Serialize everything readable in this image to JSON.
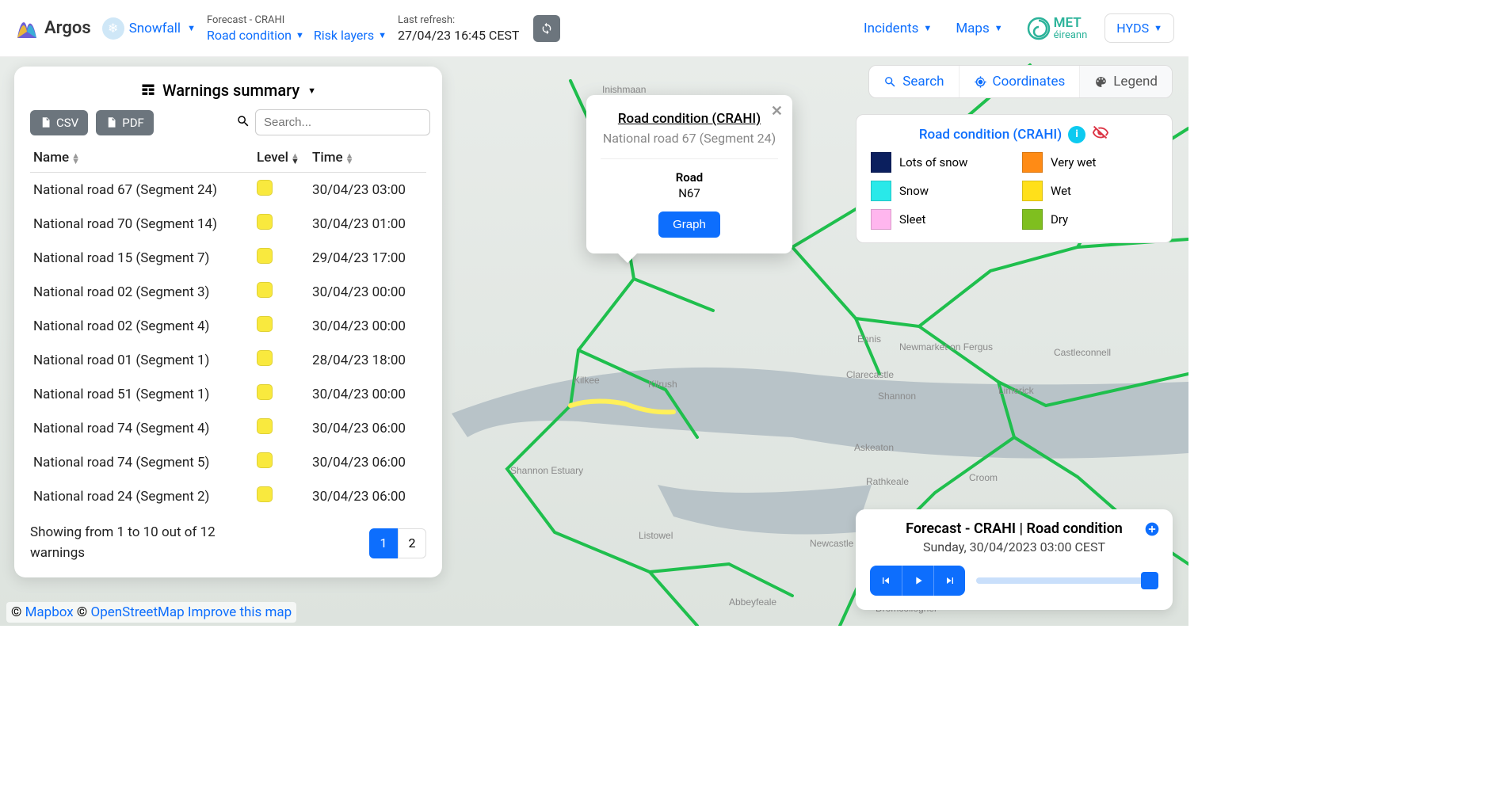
{
  "header": {
    "logo_text": "Argos",
    "snowfall": "Snowfall",
    "forecast_label": "Forecast - CRAHI",
    "road_condition": "Road condition",
    "risk_layers": "Risk layers",
    "last_refresh_label": "Last refresh:",
    "last_refresh_value": "27/04/23 16:45 CEST",
    "incidents": "Incidents",
    "maps": "Maps",
    "met_text": "MET",
    "met_sub": "éireann",
    "hyds": "HYDS"
  },
  "panel": {
    "title": "Warnings summary",
    "csv": "CSV",
    "pdf": "PDF",
    "search_placeholder": "Search...",
    "col_name": "Name",
    "col_level": "Level",
    "col_time": "Time",
    "rows": [
      {
        "name": "National road 67 (Segment 24)",
        "time": "30/04/23 03:00"
      },
      {
        "name": "National road 70 (Segment 14)",
        "time": "30/04/23 01:00"
      },
      {
        "name": "National road 15 (Segment 7)",
        "time": "29/04/23 17:00"
      },
      {
        "name": "National road 02 (Segment 3)",
        "time": "30/04/23 00:00"
      },
      {
        "name": "National road 02 (Segment 4)",
        "time": "30/04/23 00:00"
      },
      {
        "name": "National road 01 (Segment 1)",
        "time": "28/04/23 18:00"
      },
      {
        "name": "National road 51 (Segment 1)",
        "time": "30/04/23 00:00"
      },
      {
        "name": "National road 74 (Segment 4)",
        "time": "30/04/23 06:00"
      },
      {
        "name": "National road 74 (Segment 5)",
        "time": "30/04/23 06:00"
      },
      {
        "name": "National road 24 (Segment 2)",
        "time": "30/04/23 06:00"
      }
    ],
    "footer_text": "Showing from 1 to 10 out of 12 warnings",
    "pages": [
      "1",
      "2"
    ],
    "active_page": 0
  },
  "popup": {
    "title": "Road condition (CRAHI)",
    "subtitle": "National road 67 (Segment 24)",
    "field_label": "Road",
    "field_value": "N67",
    "graph_btn": "Graph"
  },
  "tabs": {
    "search": "Search",
    "coordinates": "Coordinates",
    "legend": "Legend"
  },
  "legend": {
    "head": "Road condition (CRAHI)",
    "items": [
      {
        "label": "Lots of snow",
        "color": "#0b1f5e"
      },
      {
        "label": "Very wet",
        "color": "#ff8b15"
      },
      {
        "label": "Snow",
        "color": "#29e9e9"
      },
      {
        "label": "Wet",
        "color": "#ffe01a"
      },
      {
        "label": "Sleet",
        "color": "#ffb6ee"
      },
      {
        "label": "Dry",
        "color": "#7fbf1f"
      }
    ]
  },
  "timeline": {
    "title": "Forecast - CRAHI | Road condition",
    "subtitle": "Sunday, 30/04/2023 03:00 CEST"
  },
  "attrib": {
    "copy1": "© ",
    "mapbox": "Mapbox",
    "copy2": " © ",
    "osm": "OpenStreetMap",
    "improve": "Improve this map"
  }
}
